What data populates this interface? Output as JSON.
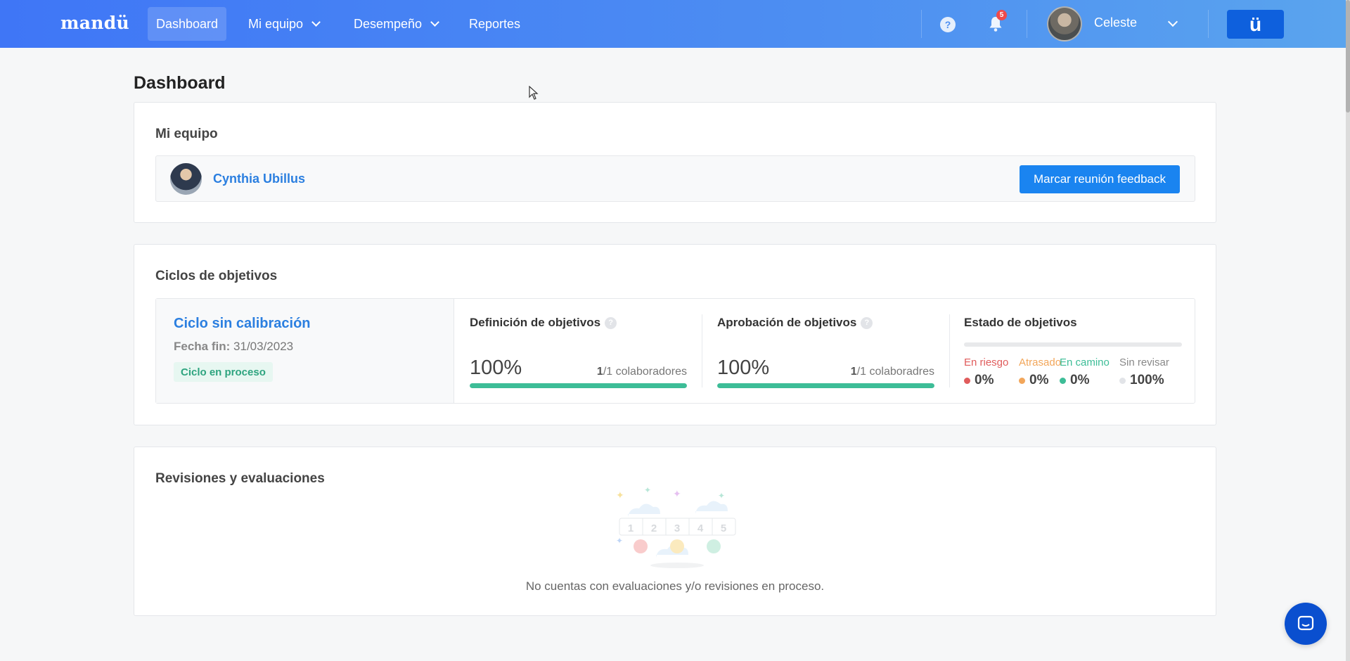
{
  "nav": {
    "brand": "mandü",
    "items": [
      {
        "label": "Dashboard",
        "active": true
      },
      {
        "label": "Mi equipo",
        "dropdown": true
      },
      {
        "label": "Desempeño",
        "dropdown": true
      },
      {
        "label": "Reportes"
      }
    ],
    "help_glyph": "?",
    "notifications_count": "5",
    "user_name": "Celeste",
    "app_button_label": "ü"
  },
  "page": {
    "title": "Dashboard"
  },
  "team": {
    "title": "Mi equipo",
    "member_name": "Cynthia Ubillus",
    "feedback_button": "Marcar reunión feedback"
  },
  "cycles": {
    "title": "Ciclos de objetivos",
    "cycle_name": "Ciclo sin calibración",
    "end_date_label": "Fecha fin:",
    "end_date": "31/03/2023",
    "status_badge": "Ciclo en proceso",
    "definition": {
      "title": "Definición de objetivos",
      "percent": "100%",
      "progress": 1.0,
      "count_done": "1",
      "count_rest": "/1 colaboradores"
    },
    "approval": {
      "title": "Aprobación de objetivos",
      "percent": "100%",
      "progress": 1.0,
      "count_done": "1",
      "count_rest": "/1 colaboradres"
    },
    "state": {
      "title": "Estado de objetivos",
      "items": [
        {
          "label": "En riesgo",
          "value": "0%",
          "color": "#e05c5c"
        },
        {
          "label": "Atrasado",
          "value": "0%",
          "color": "#f2a65a"
        },
        {
          "label": "En camino",
          "value": "0%",
          "color": "#3dbd97"
        },
        {
          "label": "Sin revisar",
          "value": "100%",
          "color": "#e2e4e8"
        }
      ]
    },
    "info_glyph": "?"
  },
  "reviews": {
    "title": "Revisiones y evaluaciones",
    "scale": [
      "1",
      "2",
      "3",
      "4",
      "5"
    ],
    "empty_text": "No cuentas con evaluaciones y/o revisiones en proceso."
  },
  "colors": {
    "accent": "#1a84f0",
    "link": "#2b7fe0",
    "success": "#3dbd97",
    "nav_start": "#3f76f6",
    "nav_end": "#5aa4ee"
  }
}
